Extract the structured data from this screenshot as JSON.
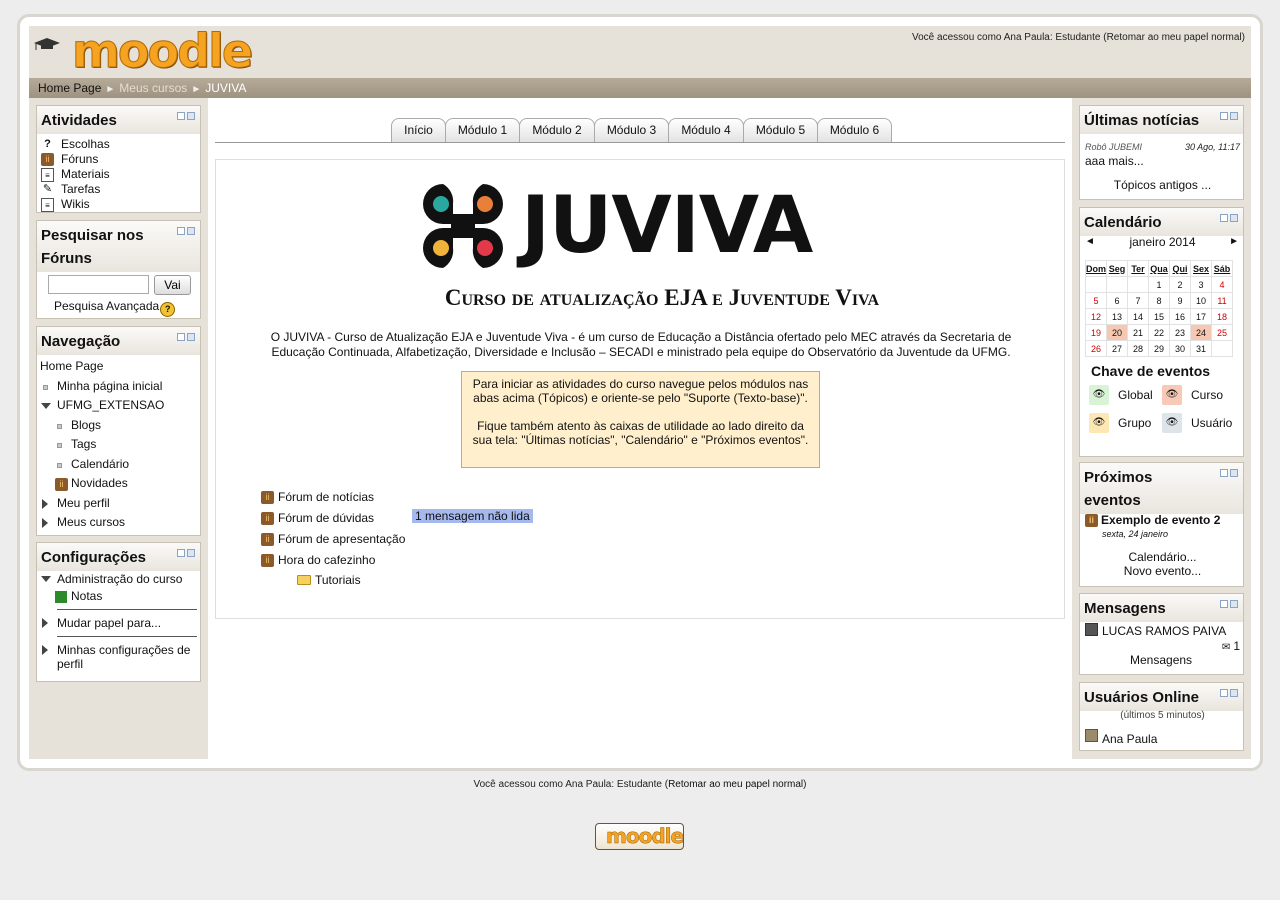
{
  "header": {
    "logo_text": "moodle",
    "login_info_text": "Você acessou como Ana Paula: Estudante (",
    "login_info_link": "Retomar ao meu papel normal",
    "login_info_end": ")"
  },
  "breadcrumb": [
    "Home Page",
    "Meus cursos",
    "JUVIVA"
  ],
  "blocks_left": {
    "atividades": {
      "title": "Atividades",
      "items": [
        {
          "label": "Escolhas",
          "icon": "question-icon"
        },
        {
          "label": "Fóruns",
          "icon": "forum-icon"
        },
        {
          "label": "Materiais",
          "icon": "document-icon"
        },
        {
          "label": "Tarefas",
          "icon": "assignment-icon"
        },
        {
          "label": "Wikis",
          "icon": "wiki-icon"
        }
      ]
    },
    "pesquisar": {
      "title_line1": "Pesquisar nos",
      "title_line2": "Fóruns",
      "input_value": "",
      "button": "Vai",
      "advanced": "Pesquisa Avançada"
    },
    "navegacao": {
      "title": "Navegação",
      "home": "Home Page",
      "items": [
        "Minha página inicial",
        "UFMG_EXTENSAO",
        "Blogs",
        "Tags",
        "Calendário",
        "Novidades",
        "Meu perfil",
        "Meus cursos"
      ]
    },
    "configuracoes": {
      "title": "Configurações",
      "admin": "Administração do curso",
      "notas": "Notas",
      "mudar": "Mudar papel para...",
      "minhas_line1": "Minhas configurações de",
      "minhas_line2": "perfil"
    }
  },
  "tabs": [
    "Início",
    "Módulo 1",
    "Módulo 2",
    "Módulo 3",
    "Módulo 4",
    "Módulo 5",
    "Módulo 6"
  ],
  "main": {
    "banner_title": "JUVIVA",
    "banner_subtitle": "Curso de atualização EJA e Juventude Viva",
    "intro_line1": "O JUVIVA - Curso de Atualização EJA e Juventude Viva - é um curso de Educação a Distância ofertado pelo MEC através da Secretaria de",
    "intro_line2": "Educação Continuada, Alfabetização, Diversidade e Inclusão – SECADI e ministrado pela equipe do Observatório da Juventude da UFMG.",
    "notice_p1": "Para iniciar as atividades do curso navegue pelos módulos nas abas acima (Tópicos) e oriente-se pelo \"Suporte (Texto-base)\".",
    "notice_p2": "Fique também atento às caixas de utilidade ao lado direito da sua tela: \"Últimas notícias\", \"Calendário\" e \"Próximos eventos\".",
    "forums": [
      "Fórum de notícias",
      "Fórum de dúvidas",
      "Fórum de apresentação",
      "Hora do cafezinho"
    ],
    "unread": "1 mensagem não lida",
    "folder": "Tutoriais"
  },
  "blocks_right": {
    "noticias": {
      "title": "Últimas notícias",
      "author": "Robô JUBEMI",
      "date": "30 Ago, 11:17",
      "text": "aaa mais...",
      "older": "Tópicos antigos ..."
    },
    "calendario": {
      "title": "Calendário",
      "prev": "◄",
      "next": "►",
      "month": "janeiro 2014",
      "weekdays": [
        "Dom",
        "Seg",
        "Ter",
        "Qua",
        "Qui",
        "Sex",
        "Sáb"
      ],
      "weeks": [
        [
          "",
          "",
          "",
          "1",
          "2",
          "3",
          "4"
        ],
        [
          "5",
          "6",
          "7",
          "8",
          "9",
          "10",
          "11"
        ],
        [
          "12",
          "13",
          "14",
          "15",
          "16",
          "17",
          "18"
        ],
        [
          "19",
          "20",
          "21",
          "22",
          "23",
          "24",
          "25"
        ],
        [
          "26",
          "27",
          "28",
          "29",
          "30",
          "31",
          ""
        ]
      ],
      "key_title": "Chave de eventos",
      "key_global": "Global",
      "key_curso": "Curso",
      "key_grupo": "Grupo",
      "key_usuario": "Usuário",
      "colors": {
        "global": "#d9f3d6",
        "curso": "#f8c9b6",
        "grupo": "#fde8b4",
        "usuario": "#dde4ea"
      }
    },
    "eventos": {
      "title_line1": "Próximos",
      "title_line2": "eventos",
      "event": "Exemplo de evento 2",
      "event_date": "sexta, 24 janeiro",
      "cal_link": "Calendário...",
      "new_link": "Novo evento..."
    },
    "mensagens": {
      "title": "Mensagens",
      "user": "LUCAS RAMOS PAIVA",
      "count": "1",
      "link": "Mensagens"
    },
    "online": {
      "title": "Usuários Online",
      "period": "(últimos 5 minutos)",
      "user": "Ana Paula"
    }
  },
  "footer": {
    "login_info_text": "Você acessou como Ana Paula: Estudante (",
    "login_info_link": "Retomar ao meu papel normal",
    "login_info_end": ")",
    "logo_text": "moodle"
  }
}
